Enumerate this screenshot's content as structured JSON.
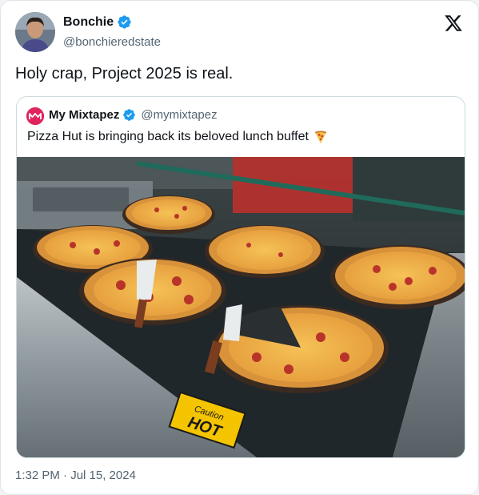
{
  "author": {
    "name": "Bonchie",
    "handle": "@bonchieredstate",
    "verified": true,
    "avatar_icon": "avatar-photo"
  },
  "tweet": {
    "text": "Holy crap, Project 2025 is real.",
    "timestamp": "1:32 PM · Jul 15, 2024"
  },
  "quoted": {
    "name": "My Mixtapez",
    "handle": "@mymixtapez",
    "verified": true,
    "text": "Pizza Hut is bringing back its beloved lunch buffet",
    "emoji": "pizza-icon",
    "media": {
      "sign_line1": "Caution",
      "sign_line2": "HOT"
    }
  },
  "colors": {
    "verified": "#1d9bf0",
    "text_primary": "#0f1419",
    "text_secondary": "#536471",
    "border": "#cfd9de",
    "brand_logo": "#e0245e",
    "caution_sign": "#f5c400"
  },
  "icons": {
    "platform": "x-logo-icon",
    "verified": "verified-badge-icon"
  }
}
